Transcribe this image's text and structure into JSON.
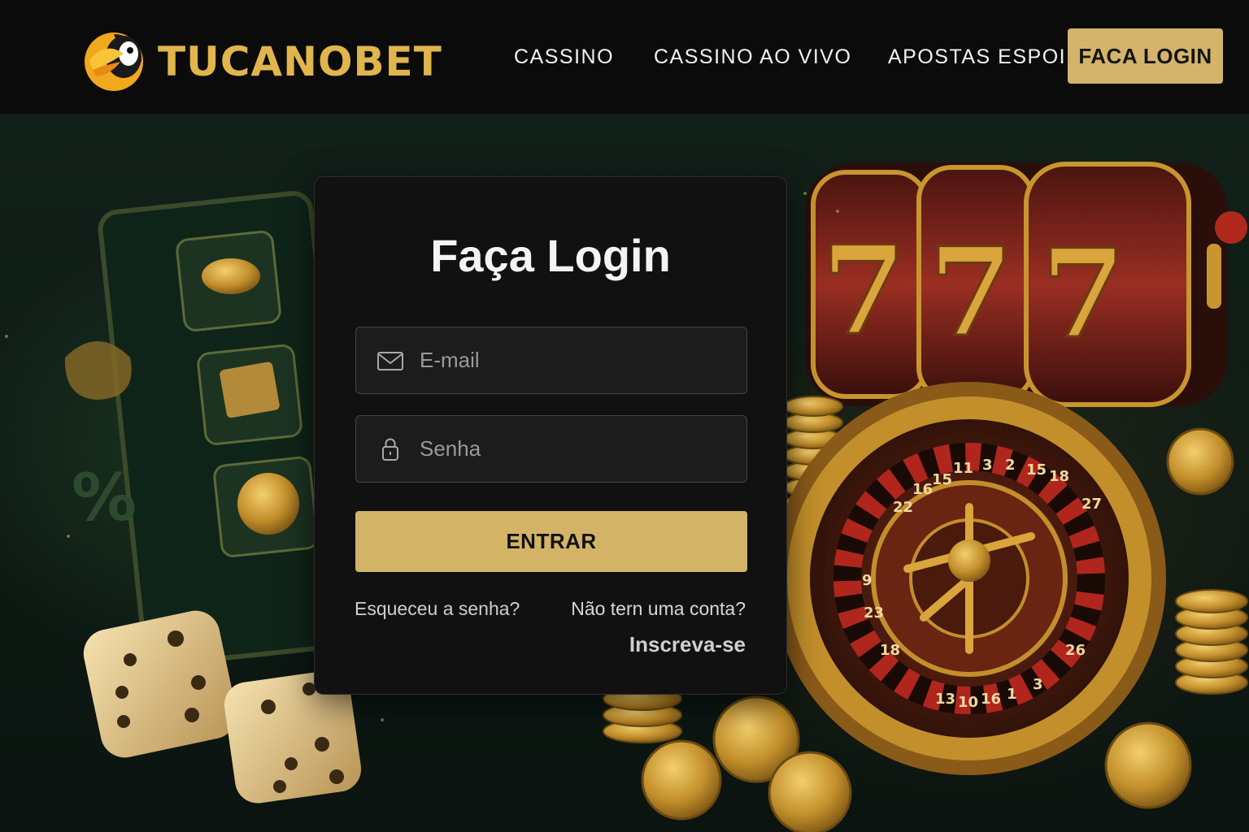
{
  "brand": {
    "name": "TUCANOBET"
  },
  "nav": {
    "items": [
      {
        "label": "CASSINO"
      },
      {
        "label": "CASSINO AO VIVO"
      },
      {
        "label": "APOSTAS ESPOI"
      }
    ],
    "login_button": "FACA LOGIN"
  },
  "login": {
    "title": "Faça Login",
    "email_placeholder": "E-mail",
    "password_placeholder": "Senha",
    "submit_label": "ENTRAR",
    "forgot_link": "Esqueceu a senha?",
    "no_account_text": "Não tern uma conta?",
    "signup_link": "Inscreva-se"
  },
  "icons": {
    "logo": "toucan-logo-icon",
    "email": "envelope-icon",
    "password": "lock-icon"
  },
  "colors": {
    "accent_gold": "#d4b46a",
    "brand_gold": "#e0b54c",
    "header_bg": "#0b0b0b",
    "card_bg": "#111111"
  },
  "background": {
    "slot_reels": [
      "7",
      "7",
      "7"
    ],
    "roulette_numbers": [
      "11",
      "3",
      "2",
      "15",
      "18",
      "16",
      "15",
      "22",
      "27",
      "9",
      "23",
      "18",
      "13",
      "10",
      "16",
      "1",
      "3",
      "26"
    ]
  }
}
